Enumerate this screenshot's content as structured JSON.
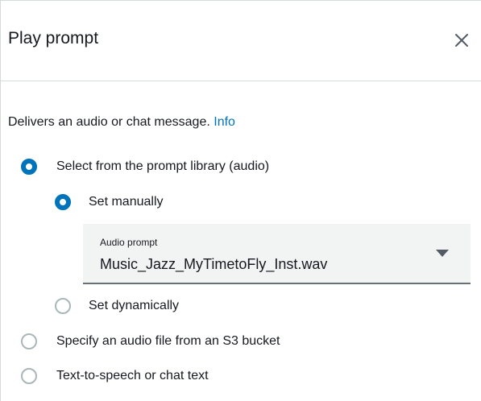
{
  "panel": {
    "title": "Play prompt",
    "close_icon": "close-icon"
  },
  "description": {
    "text": "Delivers an audio or chat message. ",
    "info_link": "Info"
  },
  "options": {
    "prompt_library": {
      "label": "Select from the prompt library (audio)",
      "checked": true
    },
    "set_manually": {
      "label": "Set manually",
      "checked": true
    },
    "set_dynamically": {
      "label": "Set dynamically",
      "checked": false
    },
    "s3_bucket": {
      "label": "Specify an audio file from an S3 bucket",
      "checked": false
    },
    "text_to_speech": {
      "label": "Text-to-speech or chat text",
      "checked": false
    }
  },
  "audio_prompt": {
    "label": "Audio prompt",
    "value": "Music_Jazz_MyTimetoFly_Inst.wav",
    "dropdown_icon": "caret-down-icon"
  },
  "colors": {
    "accent": "#0073bb",
    "text": "#16191f",
    "select_background": "#f2f3f3",
    "border": "#d5dbdb"
  }
}
